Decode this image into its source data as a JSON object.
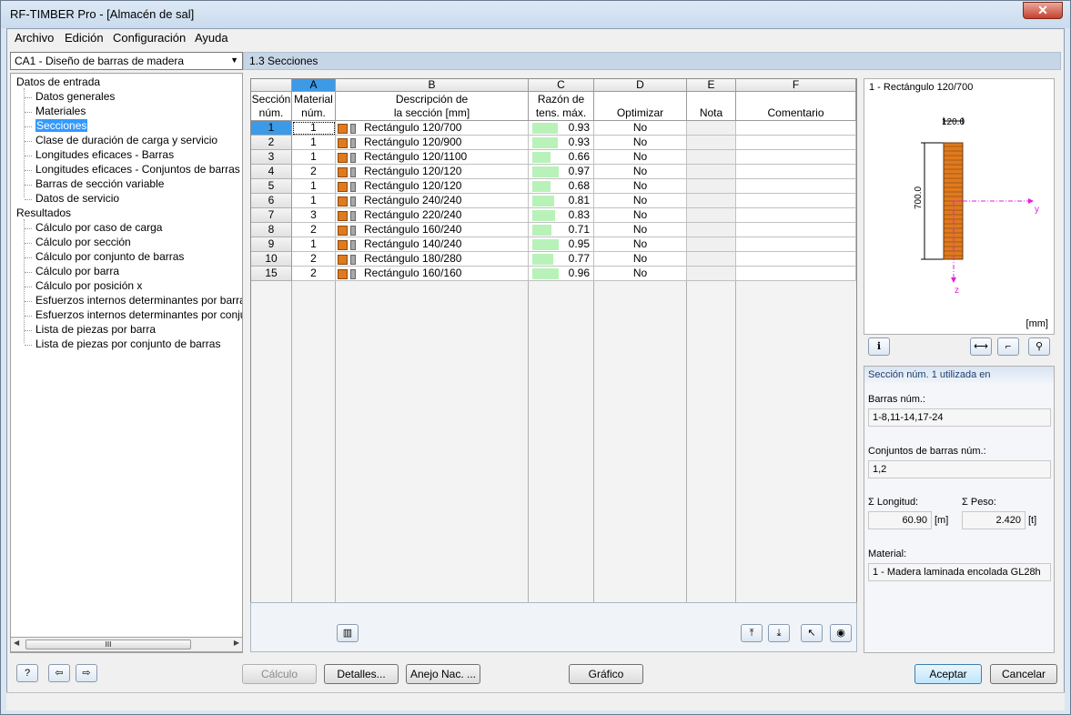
{
  "window": {
    "title": "RF-TIMBER Pro - [Almacén de sal]",
    "close_symbol": "✕"
  },
  "menu": [
    "Archivo",
    "Edición",
    "Configuración",
    "Ayuda"
  ],
  "case_selector": {
    "value": "CA1 - Diseño de barras de madera"
  },
  "tree": {
    "input_root": "Datos de entrada",
    "input_items": [
      "Datos generales",
      "Materiales",
      "Secciones",
      "Clase de duración de carga y servicio",
      "Longitudes eficaces - Barras",
      "Longitudes eficaces - Conjuntos de barras",
      "Barras de sección variable",
      "Datos de servicio"
    ],
    "results_root": "Resultados",
    "results_items": [
      "Cálculo por caso de carga",
      "Cálculo por sección",
      "Cálculo por conjunto de barras",
      "Cálculo por barra",
      "Cálculo por posición x",
      "Esfuerzos internos determinantes por barra",
      "Esfuerzos internos determinantes por conjunto",
      "Lista de piezas por barra",
      "Lista de piezas por conjunto de barras"
    ],
    "selected": "Secciones",
    "scroll_thumb_label": "III"
  },
  "section_header": "1.3 Secciones",
  "grid": {
    "col_letters": [
      "A",
      "B",
      "C",
      "D",
      "E",
      "F"
    ],
    "row_header_title_1": "Sección",
    "row_header_title_2": "núm.",
    "col_titles": [
      [
        "Material",
        "núm."
      ],
      [
        "Descripción de",
        "la sección [mm]"
      ],
      [
        "Razón de",
        "tens. máx."
      ],
      [
        "",
        "Optimizar"
      ],
      [
        "",
        "Nota"
      ],
      [
        "",
        "Comentario"
      ]
    ],
    "rows": [
      {
        "sec": "1",
        "mat": "1",
        "desc": "Rectángulo 120/700",
        "ratio": "0.93",
        "ratio_frac": 0.93,
        "opt": "No"
      },
      {
        "sec": "2",
        "mat": "1",
        "desc": "Rectángulo 120/900",
        "ratio": "0.93",
        "ratio_frac": 0.93,
        "opt": "No"
      },
      {
        "sec": "3",
        "mat": "1",
        "desc": "Rectángulo 120/1100",
        "ratio": "0.66",
        "ratio_frac": 0.66,
        "opt": "No"
      },
      {
        "sec": "4",
        "mat": "2",
        "desc": "Rectángulo 120/120",
        "ratio": "0.97",
        "ratio_frac": 0.97,
        "opt": "No"
      },
      {
        "sec": "5",
        "mat": "1",
        "desc": "Rectángulo 120/120",
        "ratio": "0.68",
        "ratio_frac": 0.68,
        "opt": "No"
      },
      {
        "sec": "6",
        "mat": "1",
        "desc": "Rectángulo 240/240",
        "ratio": "0.81",
        "ratio_frac": 0.81,
        "opt": "No"
      },
      {
        "sec": "7",
        "mat": "3",
        "desc": "Rectángulo 220/240",
        "ratio": "0.83",
        "ratio_frac": 0.83,
        "opt": "No"
      },
      {
        "sec": "8",
        "mat": "2",
        "desc": "Rectángulo 160/240",
        "ratio": "0.71",
        "ratio_frac": 0.71,
        "opt": "No"
      },
      {
        "sec": "9",
        "mat": "1",
        "desc": "Rectángulo 140/240",
        "ratio": "0.95",
        "ratio_frac": 0.95,
        "opt": "No"
      },
      {
        "sec": "10",
        "mat": "2",
        "desc": "Rectángulo 180/280",
        "ratio": "0.77",
        "ratio_frac": 0.77,
        "opt": "No"
      },
      {
        "sec": "15",
        "mat": "2",
        "desc": "Rectángulo 160/160",
        "ratio": "0.96",
        "ratio_frac": 0.96,
        "opt": "No"
      }
    ]
  },
  "preview": {
    "title": "1 - Rectángulo 120/700",
    "width_dim": "120.0",
    "height_dim": "700.0",
    "axis_y": "y",
    "axis_z": "z",
    "unit": "[mm]",
    "icons": [
      "info-icon",
      "dimension-icon",
      "axis-icon",
      "zoom-icon"
    ]
  },
  "usage": {
    "title": "Sección núm. 1 utilizada en",
    "members_label": "Barras núm.:",
    "members_value": "1-8,11-14,17-24",
    "sets_label": "Conjuntos de barras núm.:",
    "sets_value": "1,2",
    "length_label": "Σ  Longitud:",
    "length_value": "60.90",
    "length_unit": "[m]",
    "weight_label": "Σ  Peso:",
    "weight_value": "2.420",
    "weight_unit": "[t]",
    "material_label": "Material:",
    "material_value": "1 - Madera laminada encolada GL28h"
  },
  "grid_toolbar": [
    "library-icon",
    "excel-export-icon",
    "excel-import-icon",
    "select-icon",
    "view-icon"
  ],
  "footer": {
    "calc": "Cálculo",
    "details": "Detalles...",
    "annex": "Anejo Nac. ...",
    "graphic": "Gráfico",
    "ok": "Aceptar",
    "cancel": "Cancelar",
    "icons": [
      "help-icon",
      "previous-icon",
      "next-icon"
    ]
  },
  "colors": {
    "accent": "#3d9ae6",
    "swatch": "#e07a1e",
    "ratio_bar": "#b8f2b8",
    "dimension_pink": "#e020e0"
  }
}
